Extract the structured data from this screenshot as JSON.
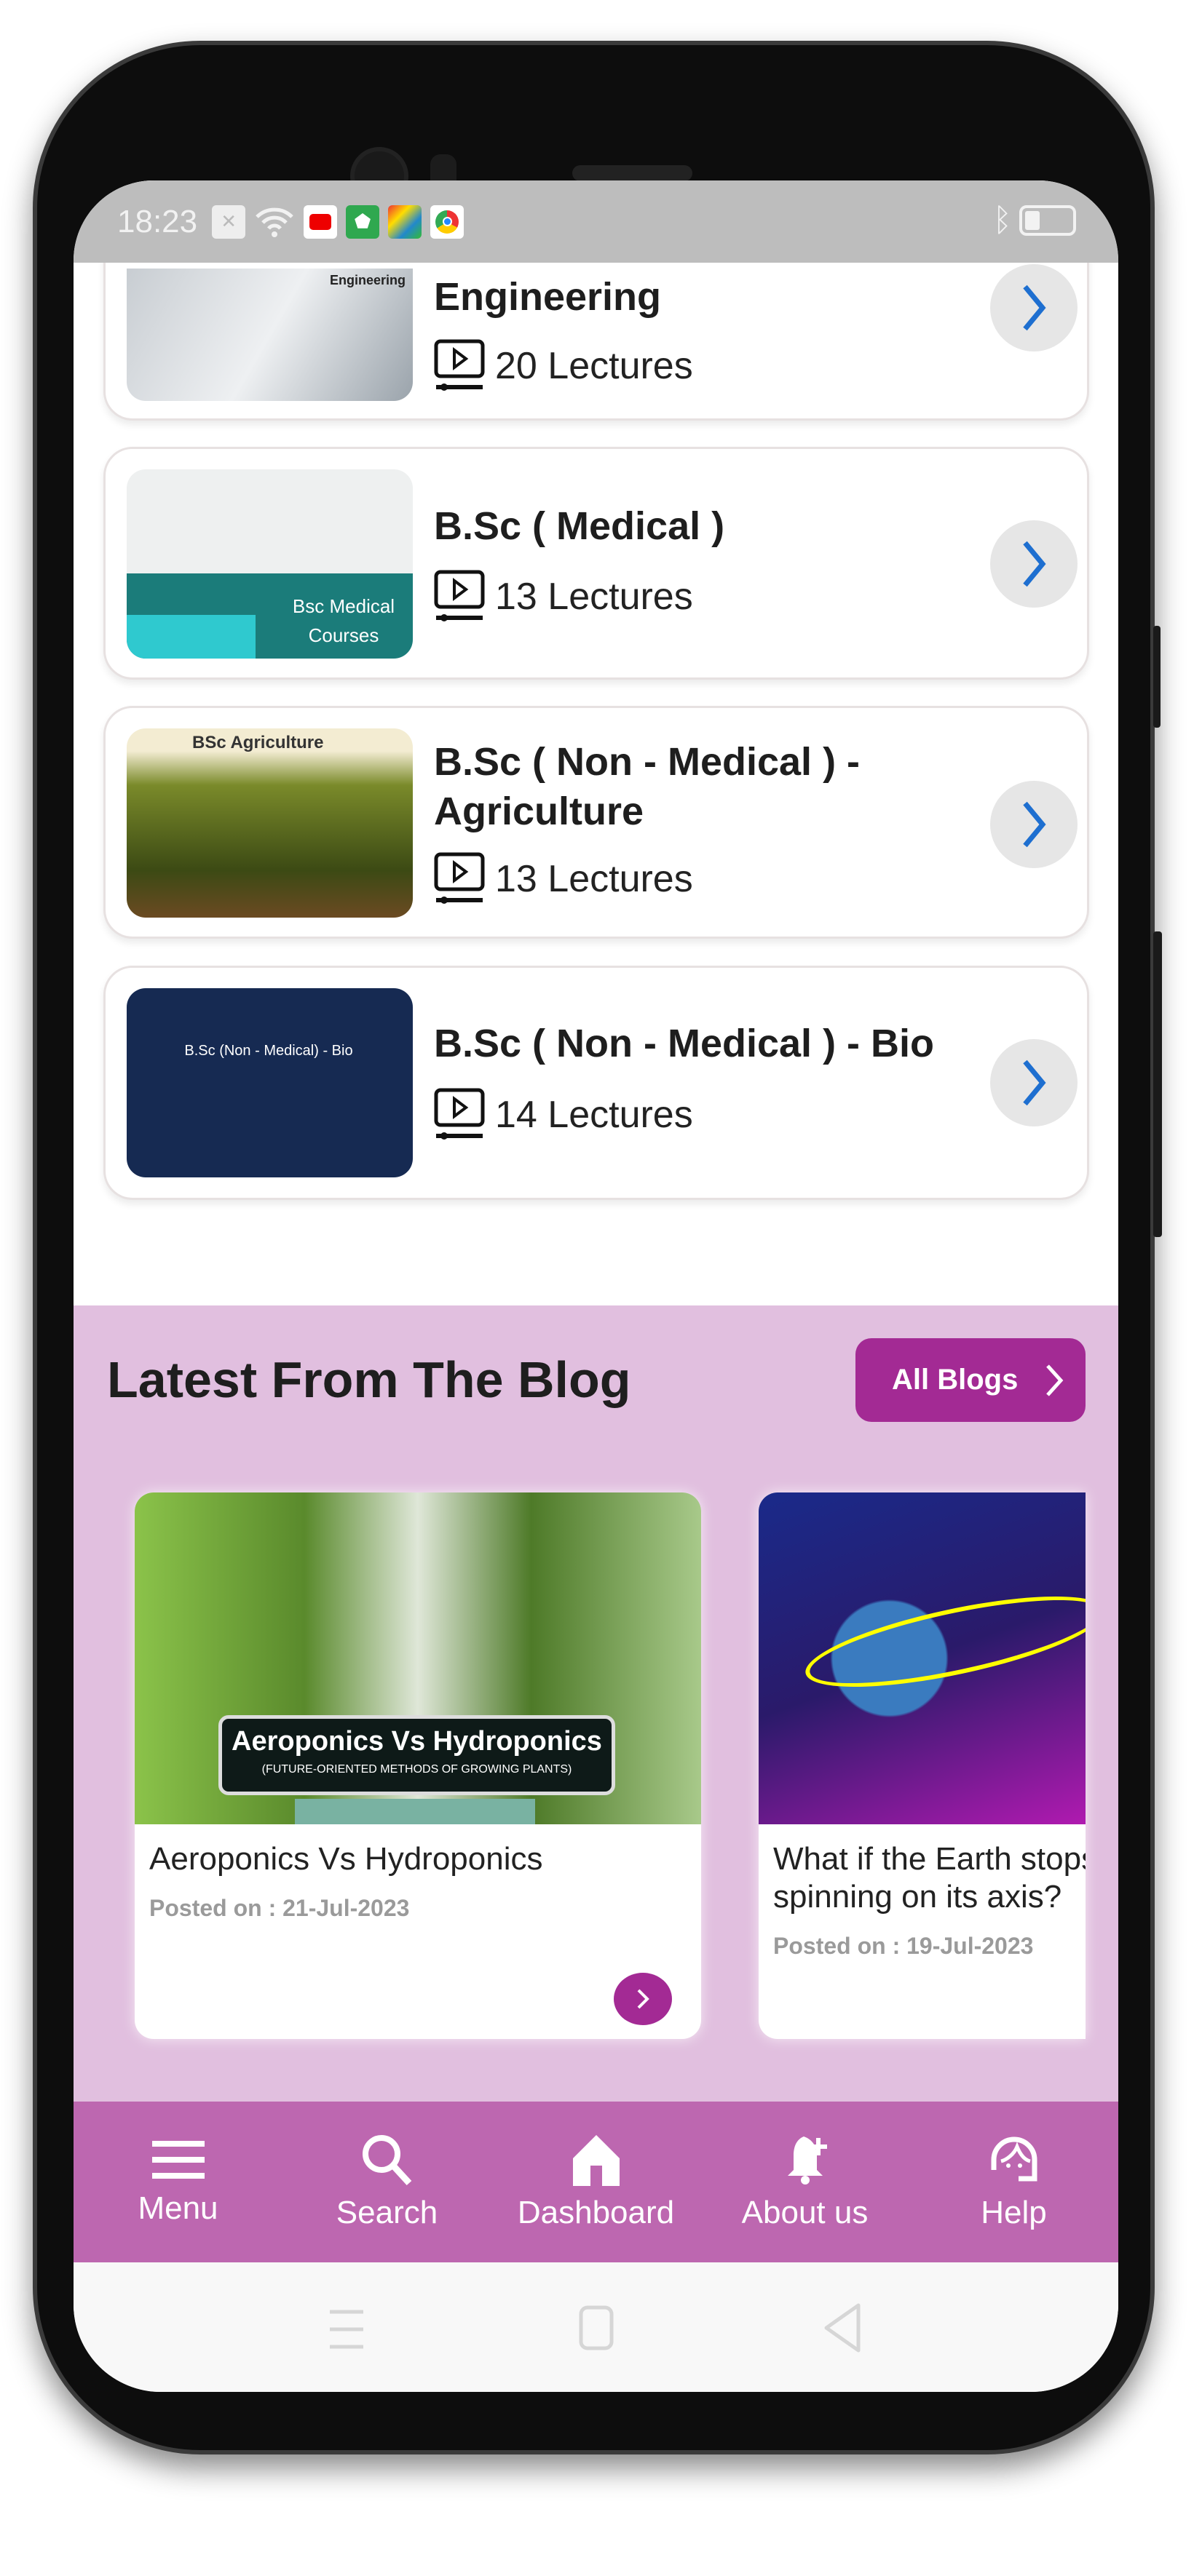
{
  "status_bar": {
    "time": "18:23",
    "icons": [
      "notification-x-icon",
      "wifi-icon",
      "youtube-icon",
      "vpn-shield-icon",
      "game-app-icon",
      "chrome-icon"
    ],
    "right_icons": [
      "bluetooth-icon",
      "battery-icon"
    ]
  },
  "courses": [
    {
      "title": "Engineering",
      "lectures": "20 Lectures",
      "thumb_text": "Engineering"
    },
    {
      "title": "B.Sc ( Medical )",
      "lectures": "13 Lectures",
      "thumb_text": "Bsc Medical Courses"
    },
    {
      "title": "B.Sc ( Non - Medical ) - Agriculture",
      "lectures": "13 Lectures",
      "thumb_text": "BSc Agriculture"
    },
    {
      "title": "B.Sc ( Non - Medical ) - Bio",
      "lectures": "14 Lectures",
      "thumb_text": "B.Sc (Non - Medical) - Bio"
    }
  ],
  "blog": {
    "heading": "Latest From The Blog",
    "all_label": "All Blogs",
    "posts": [
      {
        "title": "Aeroponics Vs Hydroponics",
        "date": "Posted on : 21-Jul-2023",
        "banner": "Aeroponics Vs Hydroponics",
        "banner_sub": "(FUTURE-ORIENTED METHODS OF GROWING PLANTS)"
      },
      {
        "title": "What if the Earth stops spinning on its axis?",
        "date": "Posted on : 19-Jul-2023"
      }
    ]
  },
  "bottom_nav": [
    {
      "label": "Menu",
      "icon": "menu-icon"
    },
    {
      "label": "Search",
      "icon": "search-icon"
    },
    {
      "label": "Dashboard",
      "icon": "home-icon"
    },
    {
      "label": "About us",
      "icon": "bell-plus-icon"
    },
    {
      "label": "Help",
      "icon": "headset-icon"
    }
  ],
  "colors": {
    "accent": "#a32a94",
    "nav": "#bd67b0",
    "blog_bg": "#e1bfdf",
    "chevron": "#1e6fd0"
  }
}
